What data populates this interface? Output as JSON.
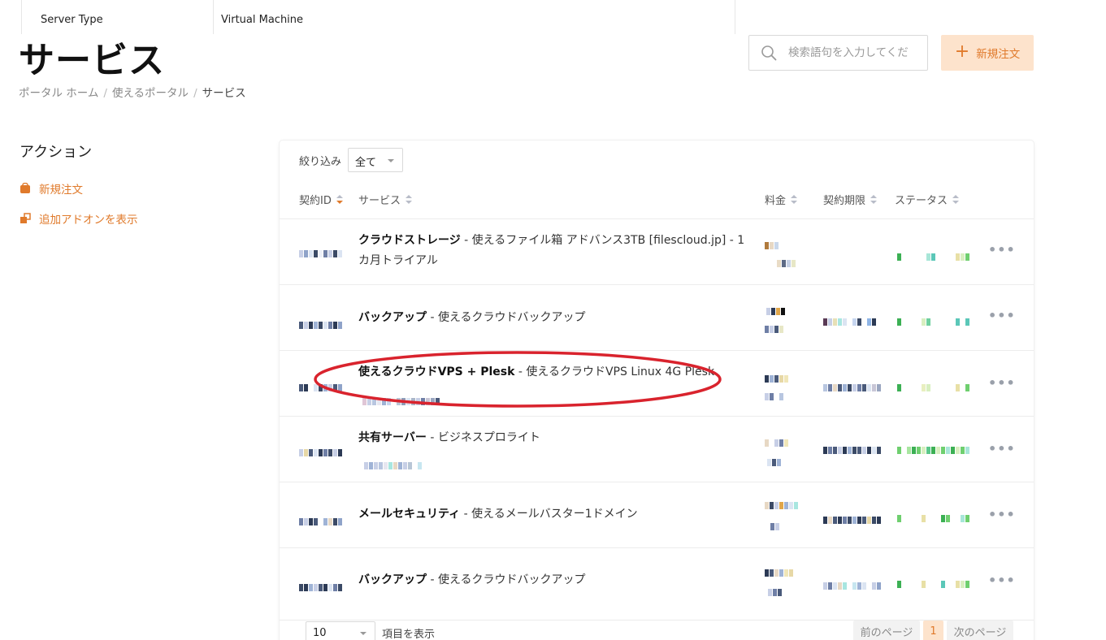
{
  "top_strip": {
    "label": "Server Type",
    "value": "Virtual Machine"
  },
  "page": {
    "title": "サービス"
  },
  "breadcrumb": {
    "home": "ポータル ホーム",
    "portal": "使えるポータル",
    "current": "サービス",
    "separator": "/"
  },
  "search": {
    "placeholder": "検索語句を入力してくだ"
  },
  "new_order_button": {
    "label": "新規注文"
  },
  "sidebar": {
    "heading": "アクション",
    "items": [
      {
        "label": "新規注文",
        "icon": "cart-icon"
      },
      {
        "label": "追加アドオンを表示",
        "icon": "addons-icon"
      }
    ]
  },
  "filter": {
    "label": "絞り込み",
    "selected": "全て"
  },
  "table": {
    "columns": {
      "id": "契約ID",
      "service": "サービス",
      "price": "料金",
      "due": "契約期限",
      "status": "ステータス"
    },
    "rows": [
      {
        "product": "クラウドストレージ",
        "detail": " - 使えるファイル箱 アドバンス3TB [filescloud.jp] - 1カ月トライアル"
      },
      {
        "product": "バックアップ",
        "detail": " - 使えるクラウドバックアップ"
      },
      {
        "product": "使えるクラウドVPS + Plesk",
        "detail": " - 使えるクラウドVPS Linux 4G Plesk"
      },
      {
        "product": "共有サーバー",
        "detail": " - ビジネスプロライト"
      },
      {
        "product": "メールセキュリティ",
        "detail": " - 使えるメールバスター1ドメイン"
      },
      {
        "product": "バックアップ",
        "detail": " - 使えるクラウドバックアップ"
      }
    ],
    "more_label": "•••"
  },
  "pagination": {
    "per_page": "10",
    "per_page_label": "項目を表示",
    "prev": "前のページ",
    "current": "1",
    "next": "次のページ"
  },
  "colors": {
    "accent": "#e07a2b",
    "accent_light": "#fde3cc",
    "highlight": "#d9232d",
    "status_green": "#3cb054"
  }
}
